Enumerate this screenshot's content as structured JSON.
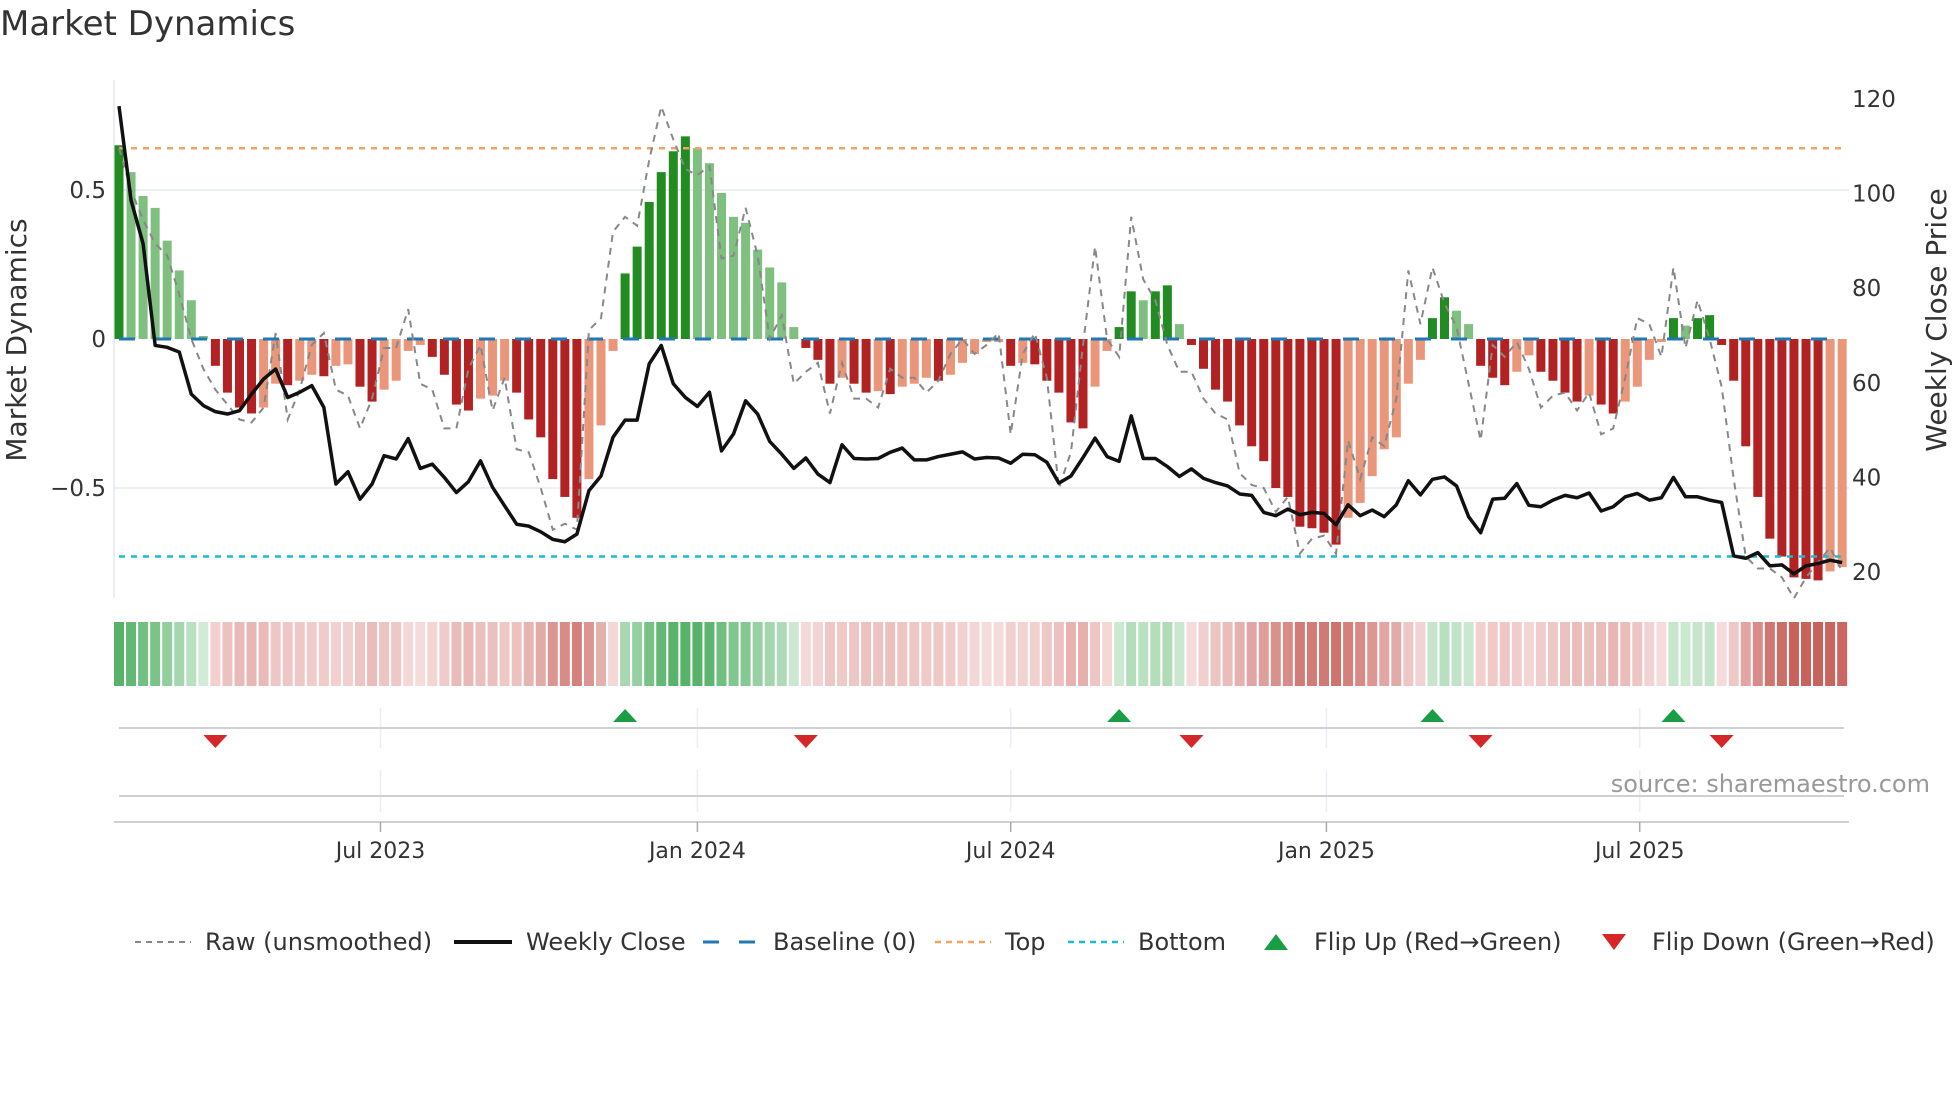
{
  "title": "Market Dynamics",
  "source": "source: sharemaestro.com",
  "colors": {
    "green_strong": "#228b22",
    "green_weak": "#7fbf7f",
    "red_strong": "#b22222",
    "red_weak": "#e9967a",
    "close": "#111111",
    "raw": "#888888",
    "baseline": "#1f77b4",
    "top": "#f4a261",
    "bottom": "#17becf",
    "flip_up": "#1a9e45",
    "flip_down": "#d62728"
  },
  "legend": [
    {
      "label": "Raw (unsmoothed)",
      "icon": "gray-dashed-line"
    },
    {
      "label": "Weekly Close",
      "icon": "black-solid-line"
    },
    {
      "label": "Baseline (0)",
      "icon": "blue-dashed-line"
    },
    {
      "label": "Top",
      "icon": "orange-dotted-line"
    },
    {
      "label": "Bottom",
      "icon": "cyan-dotted-line"
    },
    {
      "label": "Flip Up (Red→Green)",
      "icon": "green-up-triangle"
    },
    {
      "label": "Flip Down (Green→Red)",
      "icon": "red-down-triangle"
    }
  ],
  "chart_data": {
    "type": "bar",
    "title": "Market Dynamics",
    "ylabel": "Market Dynamics",
    "y2label": "Weekly Close Price",
    "ylim": [
      -0.88,
      0.86
    ],
    "y2lim": [
      15,
      125
    ],
    "yticks": [
      {
        "v": 0.5,
        "label": "0.5"
      },
      {
        "v": 0,
        "label": "0"
      },
      {
        "v": -0.5,
        "label": "−0.5"
      }
    ],
    "y2ticks": [
      {
        "v": 120,
        "label": "120"
      },
      {
        "v": 100,
        "label": "100"
      },
      {
        "v": 80,
        "label": "80"
      },
      {
        "v": 60,
        "label": "60"
      },
      {
        "v": 40,
        "label": "40"
      },
      {
        "v": 20,
        "label": "20"
      }
    ],
    "xticks": [
      {
        "week": 21.7,
        "label": "Jul 2023"
      },
      {
        "week": 48.0,
        "label": "Jan 2024"
      },
      {
        "week": 74.0,
        "label": "Jul 2024"
      },
      {
        "week": 100.2,
        "label": "Jan 2025"
      },
      {
        "week": 126.2,
        "label": "Jul 2025"
      }
    ],
    "top_level": 0.64,
    "bottom_level": -0.73,
    "baseline": 0,
    "momentum": [
      0.65,
      0.56,
      0.48,
      0.44,
      0.33,
      0.23,
      0.13,
      0.01,
      -0.09,
      -0.18,
      -0.23,
      -0.25,
      -0.23,
      -0.15,
      -0.155,
      -0.14,
      -0.12,
      -0.125,
      -0.09,
      -0.085,
      -0.16,
      -0.21,
      -0.17,
      -0.14,
      -0.04,
      -0.02,
      -0.06,
      -0.12,
      -0.22,
      -0.24,
      -0.2,
      -0.19,
      -0.14,
      -0.18,
      -0.27,
      -0.33,
      -0.47,
      -0.53,
      -0.6,
      -0.47,
      -0.29,
      -0.04,
      0.22,
      0.31,
      0.46,
      0.56,
      0.63,
      0.68,
      0.64,
      0.59,
      0.49,
      0.41,
      0.39,
      0.3,
      0.24,
      0.19,
      0.04,
      -0.03,
      -0.07,
      -0.15,
      -0.13,
      -0.15,
      -0.18,
      -0.175,
      -0.185,
      -0.16,
      -0.15,
      -0.13,
      -0.14,
      -0.12,
      -0.08,
      -0.05,
      -0.01,
      -0.01,
      -0.09,
      -0.08,
      -0.085,
      -0.14,
      -0.18,
      -0.28,
      -0.3,
      -0.16,
      -0.04,
      0.04,
      0.16,
      0.13,
      0.16,
      0.18,
      0.05,
      -0.02,
      -0.1,
      -0.17,
      -0.21,
      -0.29,
      -0.36,
      -0.41,
      -0.5,
      -0.53,
      -0.63,
      -0.635,
      -0.65,
      -0.69,
      -0.6,
      -0.55,
      -0.46,
      -0.37,
      -0.33,
      -0.15,
      -0.07,
      0.07,
      0.14,
      0.095,
      0.05,
      -0.09,
      -0.13,
      -0.155,
      -0.11,
      -0.055,
      -0.11,
      -0.14,
      -0.18,
      -0.21,
      -0.19,
      -0.22,
      -0.25,
      -0.21,
      -0.16,
      -0.07,
      -0.01,
      0.07,
      0.045,
      0.07,
      0.08,
      -0.02,
      -0.14,
      -0.36,
      -0.53,
      -0.67,
      -0.73,
      -0.8,
      -0.805,
      -0.81,
      -0.78,
      -0.765
    ],
    "raw": [
      0.64,
      0.5,
      0.4,
      0.32,
      0.28,
      0.15,
      0,
      -0.1,
      -0.17,
      -0.22,
      -0.27,
      -0.28,
      -0.23,
      0.02,
      -0.27,
      -0.17,
      -0.02,
      0.02,
      -0.17,
      -0.19,
      -0.3,
      -0.2,
      -0.03,
      -0.03,
      0.1,
      -0.15,
      -0.17,
      -0.3,
      -0.3,
      -0.1,
      -0.02,
      -0.24,
      -0.13,
      -0.37,
      -0.38,
      -0.5,
      -0.64,
      -0.62,
      -0.64,
      0.03,
      0.07,
      0.36,
      0.41,
      0.38,
      0.6,
      0.78,
      0.67,
      0.57,
      0.55,
      0.58,
      0.27,
      0.28,
      0.44,
      0.28,
      0,
      0.08,
      -0.15,
      -0.11,
      -0.08,
      -0.25,
      -0.08,
      -0.2,
      -0.2,
      -0.23,
      -0.1,
      -0.13,
      -0.13,
      -0.18,
      -0.14,
      -0.05,
      0,
      -0.05,
      -0.02,
      0.02,
      -0.32,
      -0.05,
      0.02,
      -0.13,
      -0.5,
      -0.38,
      -0.02,
      0.31,
      0,
      -0.06,
      0.41,
      0.2,
      0.13,
      -0.02,
      -0.11,
      -0.11,
      -0.2,
      -0.25,
      -0.27,
      -0.45,
      -0.49,
      -0.5,
      -0.58,
      -0.53,
      -0.72,
      -0.67,
      -0.66,
      -0.72,
      -0.34,
      -0.47,
      -0.33,
      -0.36,
      -0.2,
      0.23,
      0.05,
      0.24,
      0.12,
      0.04,
      -0.15,
      -0.34,
      -0.02,
      -0.06,
      -0.01,
      -0.1,
      -0.23,
      -0.19,
      -0.18,
      -0.24,
      -0.18,
      -0.32,
      -0.3,
      -0.13,
      0.07,
      0.05,
      -0.06,
      0.24,
      -0.03,
      0.13,
      0,
      -0.16,
      -0.47,
      -0.73,
      -0.77,
      -0.77,
      -0.8,
      -0.87,
      -0.8,
      -0.75,
      -0.7,
      -0.78
    ],
    "close": [
      118.5,
      98.6,
      89.4,
      67.9,
      67.5,
      66.5,
      57.6,
      55.2,
      53.9,
      53.4,
      54.1,
      57.6,
      60.8,
      62.9,
      56.9,
      58,
      59.4,
      54.8,
      38.6,
      41.2,
      35.4,
      38.6,
      44.6,
      43.9,
      48.2,
      41.9,
      42.8,
      40,
      36.8,
      39.1,
      43.5,
      37.9,
      34,
      30.1,
      29.7,
      28.5,
      26.9,
      26.4,
      28,
      37.2,
      40.3,
      48.5,
      52.1,
      52.1,
      64,
      67.9,
      59.8,
      56.9,
      55,
      58,
      45.6,
      49.2,
      56.2,
      53.4,
      47.6,
      44.9,
      41.9,
      44.1,
      40.7,
      38.9,
      46.9,
      44,
      43.9,
      44,
      45.3,
      46.2,
      43.7,
      43.7,
      44.4,
      44.9,
      45.4,
      43.9,
      44.2,
      44.1,
      43,
      44.9,
      44.8,
      43.2,
      38.8,
      40.3,
      44.2,
      48.3,
      44.4,
      43.4,
      53,
      44,
      44,
      42.3,
      40.2,
      41.8,
      39.8,
      38.9,
      38.2,
      36.5,
      36.2,
      32.6,
      31.9,
      33.3,
      32.1,
      32.6,
      32.4,
      30,
      34.2,
      31.9,
      33.1,
      31.7,
      34.2,
      39.3,
      36.3,
      39.6,
      40.1,
      38.2,
      31.7,
      28.3,
      35.4,
      35.6,
      38.7,
      34.1,
      33.8,
      35.2,
      36.2,
      35.7,
      36.7,
      32.9,
      33.8,
      35.9,
      36.6,
      35.2,
      35.7,
      40,
      35.9,
      35.9,
      35.2,
      34.7,
      23.4,
      22.9,
      24.1,
      21.3,
      21.5,
      19.6,
      21.3,
      21.8,
      22.5,
      22
    ],
    "legend_placement": "bottom-center"
  }
}
